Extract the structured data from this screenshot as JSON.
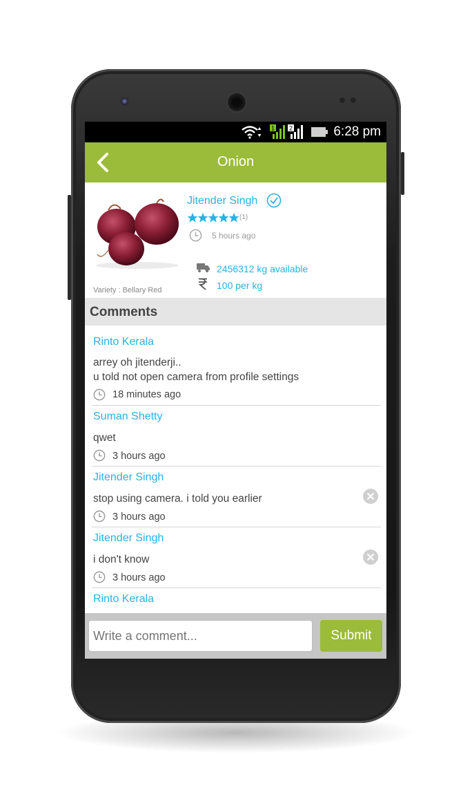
{
  "status_bar": {
    "time": "6:28 pm",
    "icons": [
      "wifi-icon",
      "sim1-signal-icon",
      "sim2-signal-icon",
      "battery-icon"
    ]
  },
  "app_bar": {
    "title": "Onion",
    "back_icon": "chevron-left-icon"
  },
  "product": {
    "variety": "Variety : Bellary Red",
    "seller": "Jitender Singh",
    "rating_count": "(1)",
    "rating_stars": 5,
    "posted": "5 hours ago",
    "availability": "2456312 kg available",
    "price": "100 per kg",
    "price_icon": "rupee-icon",
    "availability_icon": "truck-icon"
  },
  "comments_header": "Comments",
  "comments": [
    {
      "author": "Rinto Kerala",
      "text": "arrey oh jitenderji..\nu told not open camera from profile settings",
      "time": "18 minutes ago",
      "deletable": false
    },
    {
      "author": "Suman Shetty",
      "text": "qwet",
      "time": "3 hours ago",
      "deletable": false
    },
    {
      "author": "Jitender Singh",
      "text": "stop using camera.  i told you earlier",
      "time": "3 hours ago",
      "deletable": true
    },
    {
      "author": "Jitender Singh",
      "text": "i don't know",
      "time": "3 hours ago",
      "deletable": true
    },
    {
      "author": "Rinto Kerala"
    }
  ],
  "comment_input": {
    "placeholder": "Write a comment..."
  },
  "submit_label": "Submit",
  "colors": {
    "accent": "#9bbb3a",
    "link": "#26b3e3"
  }
}
